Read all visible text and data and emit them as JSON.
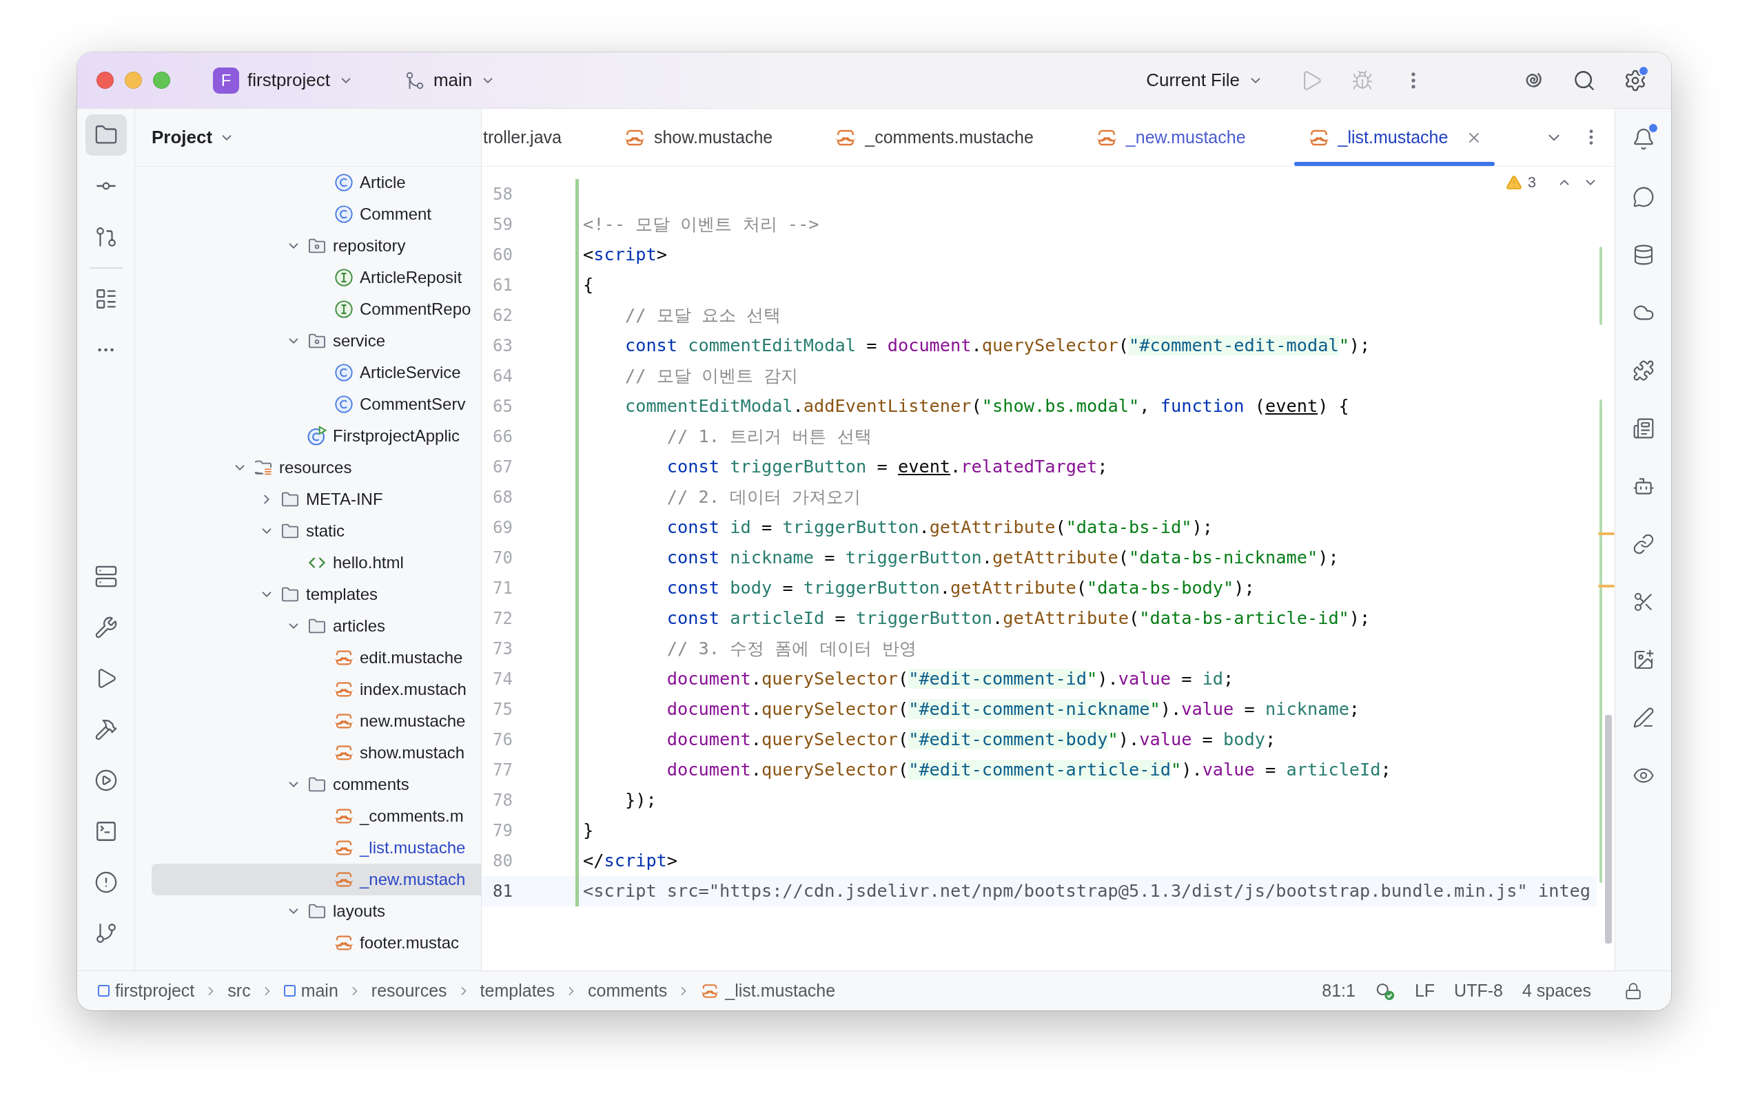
{
  "title_bar": {
    "project_badge": "F",
    "project": "firstproject",
    "branch": "main",
    "run_config": "Current File",
    "settings_badge": true
  },
  "left_toolbar": {
    "top": [
      {
        "selected": true
      },
      {
        "selected": false
      },
      {
        "selected": false
      },
      {
        "selected": false
      },
      {
        "selected": false
      }
    ],
    "bottom": [
      {
        "selected": false
      },
      {
        "selected": false
      },
      {
        "selected": false
      },
      {
        "selected": false
      },
      {
        "selected": false
      },
      {
        "selected": false
      },
      {
        "selected": false
      },
      {
        "selected": false
      }
    ]
  },
  "project_panel": {
    "title": "Project",
    "tree": [
      {
        "children": [
          {
            "children": [
              {
                "children": [
                  {
                    "label": "Article",
                    "kind": "class",
                    "selected": false
                  },
                  {
                    "label": "Comment",
                    "kind": "class",
                    "selected": false
                  }
                ]
              },
              {
                "label": "repository",
                "kind": "package",
                "expanded": true,
                "selected": false,
                "children": [
                  {
                    "label": "ArticleReposit",
                    "kind": "interface",
                    "selected": false
                  },
                  {
                    "label": "CommentRepo",
                    "kind": "interface",
                    "selected": false
                  }
                ]
              },
              {
                "label": "service",
                "kind": "package",
                "expanded": true,
                "selected": false,
                "children": [
                  {
                    "label": "ArticleService",
                    "kind": "class",
                    "selected": false
                  },
                  {
                    "label": "CommentServ",
                    "kind": "class",
                    "selected": false
                  }
                ]
              },
              {
                "label": "FirstprojectApplic",
                "kind": "app",
                "selected": false
              }
            ]
          }
        ]
      },
      {
        "label": "resources",
        "kind": "resources",
        "expanded": true,
        "selected": false,
        "children": [
          {
            "label": "META-INF",
            "kind": "folder",
            "expanded": false,
            "selected": false
          },
          {
            "label": "static",
            "kind": "folder",
            "expanded": true,
            "selected": false,
            "children": [
              {
                "label": "hello.html",
                "kind": "html",
                "selected": false
              }
            ]
          },
          {
            "label": "templates",
            "kind": "folder",
            "expanded": true,
            "selected": false,
            "children": [
              {
                "label": "articles",
                "kind": "folder",
                "expanded": true,
                "selected": false,
                "children": [
                  {
                    "label": "edit.mustache",
                    "kind": "mustache",
                    "selected": false,
                    "modified": false
                  },
                  {
                    "label": "index.mustach",
                    "kind": "mustache",
                    "selected": false,
                    "modified": false
                  },
                  {
                    "label": "new.mustache",
                    "kind": "mustache",
                    "selected": false,
                    "modified": false
                  },
                  {
                    "label": "show.mustach",
                    "kind": "mustache",
                    "selected": false,
                    "modified": false
                  }
                ]
              },
              {
                "label": "comments",
                "kind": "folder",
                "expanded": true,
                "selected": false,
                "children": [
                  {
                    "label": "_comments.m",
                    "kind": "mustache",
                    "selected": false,
                    "modified": false
                  },
                  {
                    "label": "_list.mustache",
                    "kind": "mustache",
                    "selected": false,
                    "modified": true
                  },
                  {
                    "label": "_new.mustach",
                    "kind": "mustache",
                    "selected": true,
                    "modified": true
                  }
                ]
              },
              {
                "label": "layouts",
                "kind": "folder",
                "expanded": true,
                "selected": false,
                "children": [
                  {
                    "label": "footer.mustac",
                    "kind": "mustache",
                    "selected": false,
                    "modified": false
                  }
                ]
              }
            ]
          }
        ]
      }
    ]
  },
  "tabs": [
    {
      "label": "troller.java",
      "kind": "java",
      "selected": false,
      "modified": false
    },
    {
      "label": "show.mustache",
      "kind": "mustache",
      "selected": false,
      "modified": false
    },
    {
      "label": "_comments.mustache",
      "kind": "mustache",
      "selected": false,
      "modified": false
    },
    {
      "label": "_new.mustache",
      "kind": "mustache",
      "selected": false,
      "modified": true
    },
    {
      "label": "_list.mustache",
      "kind": "mustache",
      "selected": true,
      "modified": true
    }
  ],
  "inspection": {
    "warnings": "3"
  },
  "code_lines": [
    {
      "number": "58",
      "current": false
    },
    {
      "number": "59",
      "current": false,
      "tokens": [
        {
          "kind": "comment",
          "text": "<!-- 모달 이벤트 처리 -->"
        }
      ]
    },
    {
      "number": "60",
      "current": false,
      "tokens": [
        {
          "kind": "plain",
          "text": "<"
        },
        {
          "kind": "tag",
          "text": "script"
        },
        {
          "kind": "plain",
          "text": ">"
        }
      ]
    },
    {
      "number": "61",
      "current": false,
      "tokens": [
        {
          "kind": "plain",
          "text": "{"
        }
      ]
    },
    {
      "number": "62",
      "current": false,
      "tokens": [
        {
          "kind": "comment",
          "text": "    // 모달 요소 선택"
        }
      ]
    },
    {
      "number": "63",
      "current": false,
      "tokens": [
        {
          "kind": "keyword",
          "text": "    const "
        },
        {
          "kind": "variable",
          "text": "commentEditModal"
        },
        {
          "kind": "plain",
          "text": " = "
        },
        {
          "kind": "global",
          "text": "document"
        },
        {
          "kind": "plain",
          "text": "."
        },
        {
          "kind": "method",
          "text": "querySelector"
        },
        {
          "kind": "plain",
          "text": "("
        },
        {
          "kind": "selector",
          "text": "\"#comment-edit-modal"
        },
        {
          "kind": "string",
          "text": "\""
        },
        {
          "kind": "plain",
          "text": ");"
        }
      ]
    },
    {
      "number": "64",
      "current": false,
      "tokens": [
        {
          "kind": "comment",
          "text": "    // 모달 이벤트 감지"
        }
      ]
    },
    {
      "number": "65",
      "current": false,
      "tokens": [
        {
          "kind": "variable",
          "text": "    commentEditModal"
        },
        {
          "kind": "plain",
          "text": "."
        },
        {
          "kind": "method",
          "text": "addEventListener"
        },
        {
          "kind": "plain",
          "text": "("
        },
        {
          "kind": "string",
          "text": "\"show.bs.modal\""
        },
        {
          "kind": "plain",
          "text": ", "
        },
        {
          "kind": "keyword",
          "text": "function"
        },
        {
          "kind": "plain",
          "text": " ("
        },
        {
          "kind": "param",
          "text": "event"
        },
        {
          "kind": "plain",
          "text": ") {"
        }
      ]
    },
    {
      "number": "66",
      "current": false,
      "tokens": [
        {
          "kind": "comment",
          "text": "        // 1. 트리거 버튼 선택"
        }
      ]
    },
    {
      "number": "67",
      "current": false,
      "tokens": [
        {
          "kind": "keyword",
          "text": "        const "
        },
        {
          "kind": "variable",
          "text": "triggerButton"
        },
        {
          "kind": "plain",
          "text": " = "
        },
        {
          "kind": "param",
          "text": "event"
        },
        {
          "kind": "plain",
          "text": "."
        },
        {
          "kind": "property",
          "text": "relatedTarget"
        },
        {
          "kind": "plain",
          "text": ";"
        }
      ]
    },
    {
      "number": "68",
      "current": false,
      "tokens": [
        {
          "kind": "comment",
          "text": "        // 2. 데이터 가져오기"
        }
      ]
    },
    {
      "number": "69",
      "current": false,
      "tokens": [
        {
          "kind": "keyword",
          "text": "        const "
        },
        {
          "kind": "variable",
          "text": "id"
        },
        {
          "kind": "plain",
          "text": " = "
        },
        {
          "kind": "variable",
          "text": "triggerButton"
        },
        {
          "kind": "plain",
          "text": "."
        },
        {
          "kind": "method",
          "text": "getAttribute"
        },
        {
          "kind": "plain",
          "text": "("
        },
        {
          "kind": "string",
          "text": "\"data-bs-id\""
        },
        {
          "kind": "plain",
          "text": ");"
        }
      ]
    },
    {
      "number": "70",
      "current": false,
      "tokens": [
        {
          "kind": "keyword",
          "text": "        const "
        },
        {
          "kind": "variable",
          "text": "nickname"
        },
        {
          "kind": "plain",
          "text": " = "
        },
        {
          "kind": "variable",
          "text": "triggerButton"
        },
        {
          "kind": "plain",
          "text": "."
        },
        {
          "kind": "method",
          "text": "getAttribute"
        },
        {
          "kind": "plain",
          "text": "("
        },
        {
          "kind": "string",
          "text": "\"data-bs-nickname\""
        },
        {
          "kind": "plain",
          "text": ");"
        }
      ]
    },
    {
      "number": "71",
      "current": false,
      "tokens": [
        {
          "kind": "keyword",
          "text": "        const "
        },
        {
          "kind": "variable",
          "text": "body"
        },
        {
          "kind": "plain",
          "text": " = "
        },
        {
          "kind": "variable",
          "text": "triggerButton"
        },
        {
          "kind": "plain",
          "text": "."
        },
        {
          "kind": "method",
          "text": "getAttribute"
        },
        {
          "kind": "plain",
          "text": "("
        },
        {
          "kind": "string",
          "text": "\"data-bs-body\""
        },
        {
          "kind": "plain",
          "text": ");"
        }
      ]
    },
    {
      "number": "72",
      "current": false,
      "tokens": [
        {
          "kind": "keyword",
          "text": "        const "
        },
        {
          "kind": "variable",
          "text": "articleId"
        },
        {
          "kind": "plain",
          "text": " = "
        },
        {
          "kind": "variable",
          "text": "triggerButton"
        },
        {
          "kind": "plain",
          "text": "."
        },
        {
          "kind": "method",
          "text": "getAttribute"
        },
        {
          "kind": "plain",
          "text": "("
        },
        {
          "kind": "string",
          "text": "\"data-bs-article-id\""
        },
        {
          "kind": "plain",
          "text": ");"
        }
      ]
    },
    {
      "number": "73",
      "current": false,
      "tokens": [
        {
          "kind": "comment",
          "text": "        // 3. 수정 폼에 데이터 반영"
        }
      ]
    },
    {
      "number": "74",
      "current": false,
      "tokens": [
        {
          "kind": "global",
          "text": "        document"
        },
        {
          "kind": "plain",
          "text": "."
        },
        {
          "kind": "method",
          "text": "querySelector"
        },
        {
          "kind": "plain",
          "text": "("
        },
        {
          "kind": "selector",
          "text": "\"#edit-comment-id"
        },
        {
          "kind": "string",
          "text": "\""
        },
        {
          "kind": "plain",
          "text": ")."
        },
        {
          "kind": "property",
          "text": "value"
        },
        {
          "kind": "plain",
          "text": " = "
        },
        {
          "kind": "variable",
          "text": "id"
        },
        {
          "kind": "plain",
          "text": ";"
        }
      ]
    },
    {
      "number": "75",
      "current": false,
      "tokens": [
        {
          "kind": "global",
          "text": "        document"
        },
        {
          "kind": "plain",
          "text": "."
        },
        {
          "kind": "method",
          "text": "querySelector"
        },
        {
          "kind": "plain",
          "text": "("
        },
        {
          "kind": "selector",
          "text": "\"#edit-comment-nickname"
        },
        {
          "kind": "string",
          "text": "\""
        },
        {
          "kind": "plain",
          "text": ")."
        },
        {
          "kind": "property",
          "text": "value"
        },
        {
          "kind": "plain",
          "text": " = "
        },
        {
          "kind": "variable",
          "text": "nickname"
        },
        {
          "kind": "plain",
          "text": ";"
        }
      ]
    },
    {
      "number": "76",
      "current": false,
      "tokens": [
        {
          "kind": "global",
          "text": "        document"
        },
        {
          "kind": "plain",
          "text": "."
        },
        {
          "kind": "method",
          "text": "querySelector"
        },
        {
          "kind": "plain",
          "text": "("
        },
        {
          "kind": "selector",
          "text": "\"#edit-comment-body"
        },
        {
          "kind": "string",
          "text": "\""
        },
        {
          "kind": "plain",
          "text": ")."
        },
        {
          "kind": "property",
          "text": "value"
        },
        {
          "kind": "plain",
          "text": " = "
        },
        {
          "kind": "variable",
          "text": "body"
        },
        {
          "kind": "plain",
          "text": ";"
        }
      ]
    },
    {
      "number": "77",
      "current": false,
      "tokens": [
        {
          "kind": "global",
          "text": "        document"
        },
        {
          "kind": "plain",
          "text": "."
        },
        {
          "kind": "method",
          "text": "querySelector"
        },
        {
          "kind": "plain",
          "text": "("
        },
        {
          "kind": "selector",
          "text": "\"#edit-comment-article-id"
        },
        {
          "kind": "string",
          "text": "\""
        },
        {
          "kind": "plain",
          "text": ")."
        },
        {
          "kind": "property",
          "text": "value"
        },
        {
          "kind": "plain",
          "text": " = "
        },
        {
          "kind": "variable",
          "text": "articleId"
        },
        {
          "kind": "plain",
          "text": ";"
        }
      ]
    },
    {
      "number": "78",
      "current": false,
      "tokens": [
        {
          "kind": "plain",
          "text": "    });"
        }
      ]
    },
    {
      "number": "79",
      "current": false,
      "tokens": [
        {
          "kind": "plain",
          "text": "}"
        }
      ]
    },
    {
      "number": "80",
      "current": false,
      "tokens": [
        {
          "kind": "plain",
          "text": "</"
        },
        {
          "kind": "tag",
          "text": "script"
        },
        {
          "kind": "plain",
          "text": ">"
        }
      ]
    },
    {
      "number": "81",
      "current": true,
      "tokens": [
        {
          "kind": "muted",
          "text": "<script src=\"https://cdn.jsdelivr.net/npm/bootstrap@5.1.3/dist/js/bootstrap.bundle.min.js\" integ"
        }
      ]
    }
  ],
  "right_toolbar": {
    "notification_badge": true
  },
  "status_bar": {
    "breadcrumbs": [
      {
        "label": "firstproject",
        "kind": "module"
      },
      {
        "label": "src",
        "kind": "folder"
      },
      {
        "label": "main",
        "kind": "module"
      },
      {
        "label": "resources",
        "kind": "folder"
      },
      {
        "label": "templates",
        "kind": "folder"
      },
      {
        "label": "comments",
        "kind": "folder"
      },
      {
        "label": "_list.mustache",
        "kind": "mustache"
      }
    ],
    "position": "81:1",
    "line_separator": "LF",
    "encoding": "UTF-8",
    "indent": "4 spaces"
  }
}
